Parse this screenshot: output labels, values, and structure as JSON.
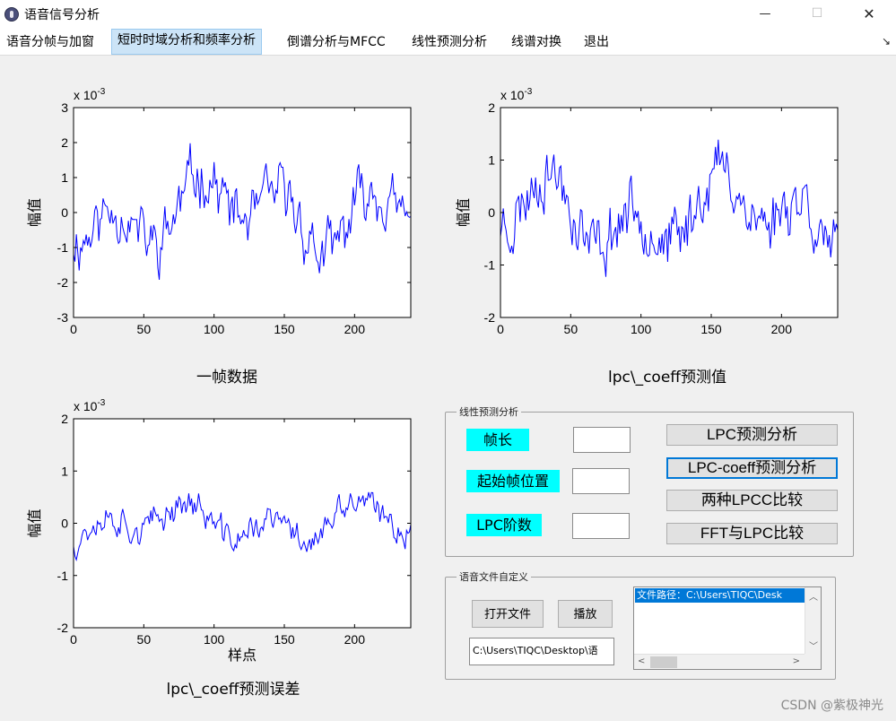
{
  "window": {
    "title": "语音信号分析",
    "controls": {
      "minimize": "—",
      "maximize": "☐",
      "close": "✕"
    }
  },
  "menu": {
    "items": [
      {
        "label": "语音分帧与加窗"
      },
      {
        "label": "短时时域分析和频率分析",
        "active": true
      },
      {
        "label": "倒谱分析与MFCC"
      },
      {
        "label": "线性预测分析"
      },
      {
        "label": "线谱对换"
      },
      {
        "label": "退出"
      }
    ],
    "overflow_icon": "↘"
  },
  "plots": [
    {
      "id": "frame",
      "title": "一帧数据",
      "ylabel": "幅值",
      "xlabel": "",
      "exponent": "x 10",
      "exponent_power": "-3",
      "ylim": [
        -3,
        3
      ],
      "yticks": [
        -3,
        -2,
        -1,
        0,
        1,
        2,
        3
      ],
      "xticks": [
        0,
        50,
        100,
        150,
        200
      ],
      "xlim": [
        0,
        240
      ],
      "line_color": "#0000ff",
      "series_seed": 11,
      "series_amp": 1.25
    },
    {
      "id": "pred",
      "title": "lpc\\_coeff预测值",
      "ylabel": "幅值",
      "xlabel": "",
      "exponent": "x 10",
      "exponent_power": "-3",
      "ylim": [
        -2,
        2
      ],
      "yticks": [
        -2,
        -1,
        0,
        1,
        2
      ],
      "xticks": [
        0,
        50,
        100,
        150,
        200
      ],
      "xlim": [
        0,
        240
      ],
      "line_color": "#0000ff",
      "series_seed": 23,
      "series_amp": 0.9
    },
    {
      "id": "err",
      "title": "lpc\\_coeff预测误差",
      "ylabel": "幅值",
      "xlabel": "样点",
      "exponent": "x 10",
      "exponent_power": "-3",
      "ylim": [
        -2,
        2
      ],
      "yticks": [
        -2,
        -1,
        0,
        1,
        2
      ],
      "xticks": [
        0,
        50,
        100,
        150,
        200
      ],
      "xlim": [
        0,
        240
      ],
      "line_color": "#0000ff",
      "series_seed": 37,
      "series_amp": 0.45
    }
  ],
  "lpc_panel": {
    "title": "线性预测分析",
    "labels": {
      "frame_len": "帧长",
      "start_pos": "起始帧位置",
      "order": "LPC阶数"
    },
    "buttons": {
      "lpc": "LPC预测分析",
      "lpc_coeff": "LPC-coeff预测分析",
      "lpcc": "两种LPCC比较",
      "fft": "FFT与LPC比较"
    }
  },
  "file_panel": {
    "title": "语音文件自定义",
    "open_button": "打开文件",
    "play_button": "播放",
    "path_value": "C:\\Users\\TIQC\\Desktop\\语",
    "list_item": "文件路径：C:\\Users\\TIQC\\Desk"
  },
  "watermark": "CSDN @紫极神光"
}
